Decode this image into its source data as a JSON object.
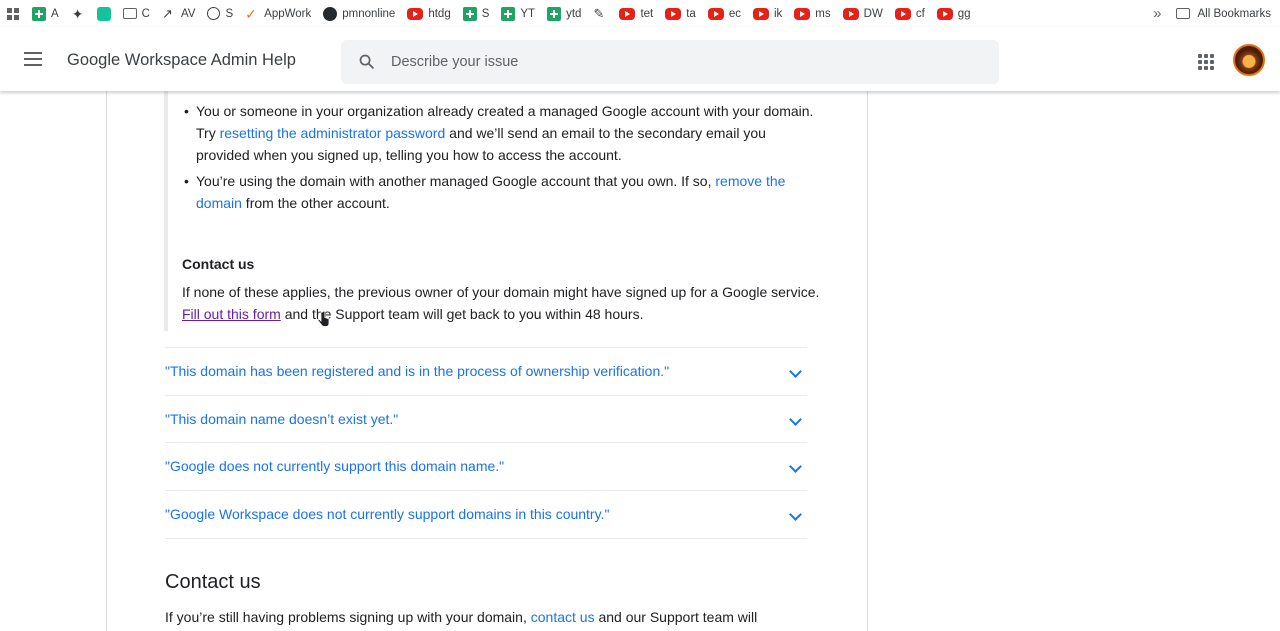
{
  "bookmarks": {
    "items": [
      {
        "label": "",
        "icon": "apps-grid-icon"
      },
      {
        "label": "A",
        "icon": "sheets-icon"
      },
      {
        "label": "",
        "icon": "extension-puzzle-icon"
      },
      {
        "label": "",
        "icon": "grammarly-icon"
      },
      {
        "label": "C",
        "icon": "folder-icon"
      },
      {
        "label": "AV",
        "icon": "trend-icon"
      },
      {
        "label": "S",
        "icon": "globe-icon"
      },
      {
        "label": "AppWork",
        "icon": "appwork-icon"
      },
      {
        "label": "pmnonline",
        "icon": "github-icon"
      },
      {
        "label": "htdg",
        "icon": "youtube-icon"
      },
      {
        "label": "S",
        "icon": "sheets-icon"
      },
      {
        "label": "YT",
        "icon": "sheets-icon"
      },
      {
        "label": "ytd",
        "icon": "sheets-icon"
      },
      {
        "label": "",
        "icon": "pin-icon"
      },
      {
        "label": "tet",
        "icon": "youtube-icon"
      },
      {
        "label": "ta",
        "icon": "youtube-icon"
      },
      {
        "label": "ec",
        "icon": "youtube-icon"
      },
      {
        "label": "ik",
        "icon": "youtube-icon"
      },
      {
        "label": "ms",
        "icon": "youtube-icon"
      },
      {
        "label": "DW",
        "icon": "youtube-icon"
      },
      {
        "label": "cf",
        "icon": "youtube-icon"
      },
      {
        "label": "gg",
        "icon": "youtube-icon"
      }
    ],
    "more": "»",
    "all_bookmarks": "All Bookmarks"
  },
  "header": {
    "title": "Google Workspace Admin Help",
    "search_placeholder": "Describe your issue"
  },
  "content": {
    "bullet1": {
      "pre": "You or someone in your organization already created a managed Google account with your domain. Try ",
      "link": "resetting the administrator password",
      "post": " and we’ll send an email to the secondary email you provided when you signed up, telling you how to access the account."
    },
    "bullet2": {
      "pre": "You’re using the domain with another managed Google account that you own. If so, ",
      "link": "remove the domain",
      "post": " from the other account."
    },
    "contact_subheading": "Contact us",
    "contact_para": {
      "pre": "If none of these applies, the previous owner of your domain might have signed up for a Google service. ",
      "link": "Fill out this form",
      "post": " and the Support team will get back to you within 48 hours."
    },
    "faqs": [
      "\"This domain has been registered and is in the process of ownership verification.\"",
      "\"This domain name doesn’t exist yet.\"",
      "\"Google does not currently support this domain name.\"",
      "\"Google Workspace does not currently support domains in this country.\""
    ],
    "contact_heading": "Contact us",
    "bottom_para": {
      "pre": "If you’re still having problems signing up with your domain, ",
      "link": "contact us",
      "post": " and our Support team will"
    }
  },
  "colors": {
    "link": "#1a73e8",
    "visited_link": "#681da8",
    "text": "#202124"
  }
}
